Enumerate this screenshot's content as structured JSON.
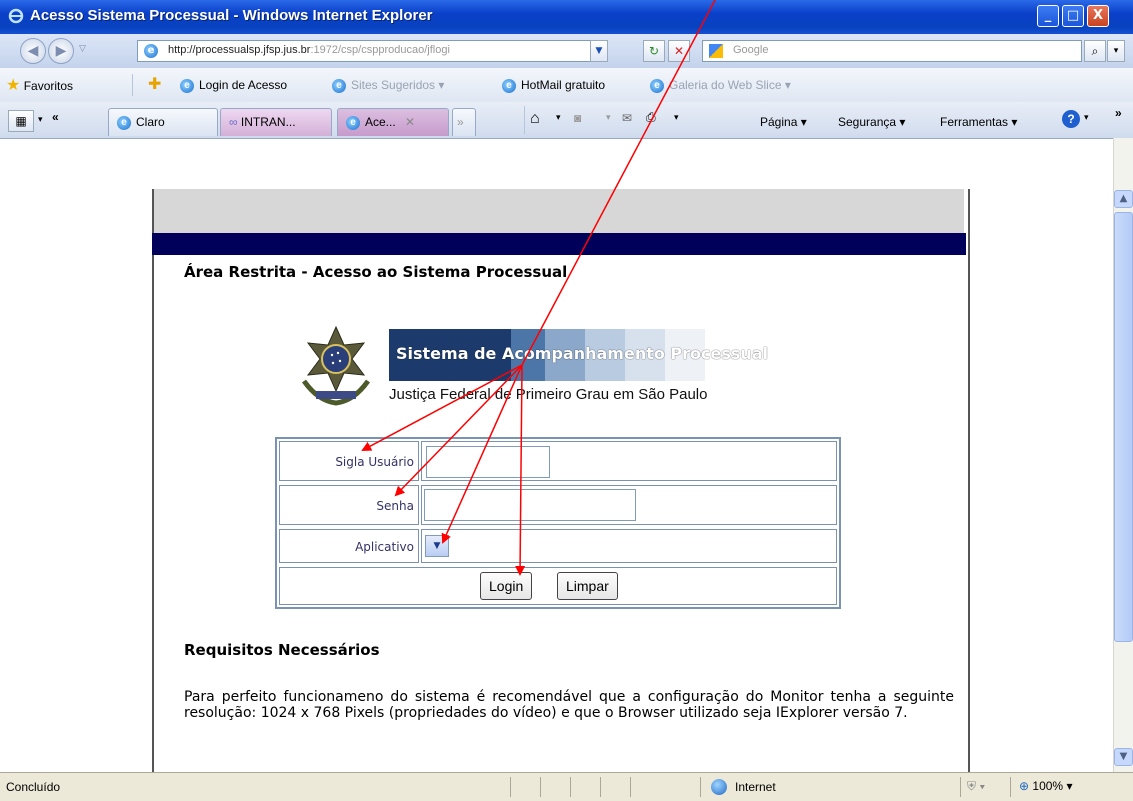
{
  "window": {
    "title": "Acesso Sistema Processual - Windows Internet Explorer",
    "minimize": "_",
    "maximize": "□",
    "close": "X"
  },
  "address_bar": {
    "url_host": "http://processualsp.jfsp.jus.br",
    "url_rest": ":1972/csp/cspproducao/jflogi",
    "search_placeholder": "Google"
  },
  "favorites_bar": {
    "favorites_label": "Favoritos",
    "items": [
      {
        "label": "Login de Acesso"
      },
      {
        "label": "Sites Sugeridos ▾"
      },
      {
        "label": "HotMail gratuito"
      },
      {
        "label": "Galeria do Web Slice ▾"
      }
    ]
  },
  "tabs": {
    "items": [
      {
        "label": "Claro"
      },
      {
        "label": "INTRAN..."
      },
      {
        "label": "Ace..."
      }
    ],
    "close_glyph": "✕",
    "more_glyph": "»"
  },
  "commands": {
    "pagina": "Página ▾",
    "seguranca": "Segurança ▾",
    "ferramentas": "Ferramentas ▾",
    "overflow": "»"
  },
  "page": {
    "heading": "Área Restrita - Acesso ao Sistema Processual",
    "logo_title": "Sistema de Acompanhamento Processual",
    "logo_subtitle": "Justiça Federal de Primeiro Grau em São Paulo",
    "form": {
      "user_label": "Sigla Usuário",
      "user_value": "",
      "password_label": "Senha",
      "password_value": "",
      "app_label": "Aplicativo",
      "login_button": "Login",
      "clear_button": "Limpar"
    },
    "requirements_title": "Requisitos Necessários",
    "requirements_text": "Para perfeito funcionameno do sistema é recomendável que a configuração do Monitor tenha a seguinte resolução: 1024 x 768 Pixels (propriedades do vídeo) e que o Browser utilizado seja IExplorer versão 7."
  },
  "status_bar": {
    "status": "Concluído",
    "zone": "Internet",
    "zoom": "100%"
  },
  "colors": {
    "navy_band": "#00005a",
    "gray_band": "#d7d7d7",
    "annotation_arrow": "#ff0000"
  }
}
